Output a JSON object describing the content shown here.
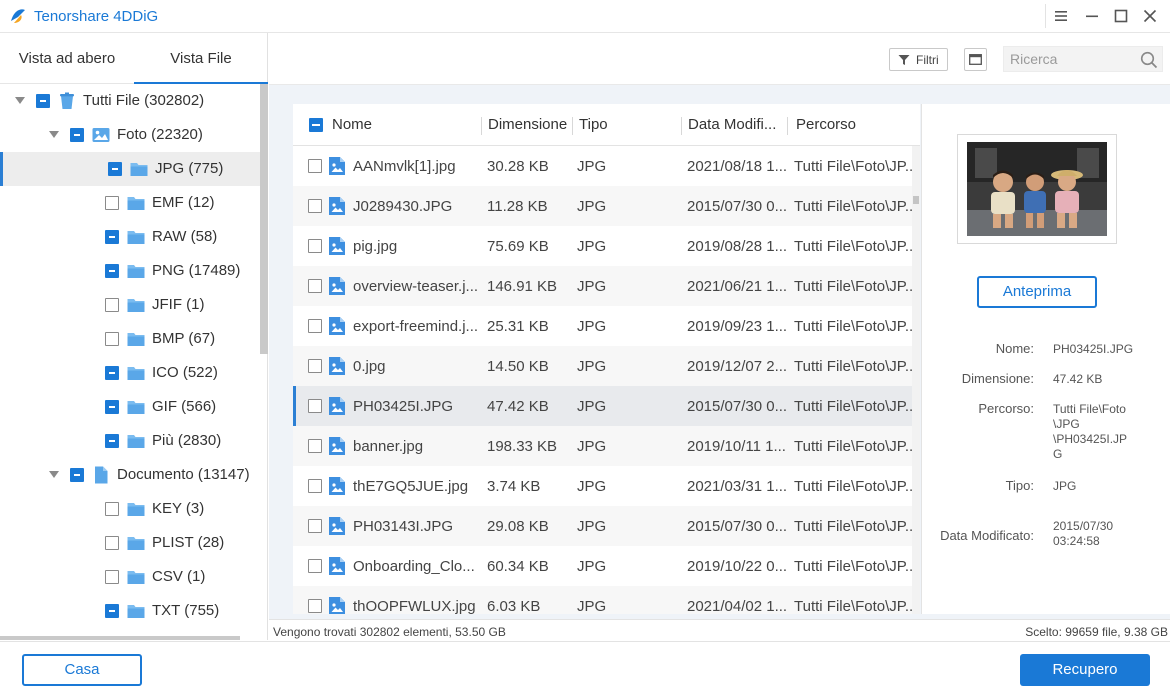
{
  "app": {
    "title": "Tenorshare 4DDiG",
    "logo": "4ddig-logo-icon"
  },
  "window_controls": [
    "menu-icon",
    "minimize-icon",
    "maximize-icon",
    "close-icon"
  ],
  "tabs": [
    {
      "label": "Vista ad abero",
      "active": false
    },
    {
      "label": "Vista File",
      "active": true
    }
  ],
  "tree": [
    {
      "label": "Tutti File (302802)",
      "level": 0,
      "expanded": true,
      "check": "partial",
      "icon": "trash-icon"
    },
    {
      "label": "Foto (22320)",
      "level": 1,
      "expanded": true,
      "check": "partial",
      "icon": "image-icon"
    },
    {
      "label": "JPG (775)",
      "level": 2,
      "check": "partial",
      "icon": "folder-icon",
      "selected": true
    },
    {
      "label": "EMF (12)",
      "level": 2,
      "check": "none",
      "icon": "folder-icon"
    },
    {
      "label": "RAW (58)",
      "level": 2,
      "check": "partial",
      "icon": "folder-icon"
    },
    {
      "label": "PNG (17489)",
      "level": 2,
      "check": "partial",
      "icon": "folder-icon"
    },
    {
      "label": "JFIF (1)",
      "level": 2,
      "check": "none",
      "icon": "folder-icon"
    },
    {
      "label": "BMP (67)",
      "level": 2,
      "check": "none",
      "icon": "folder-icon"
    },
    {
      "label": "ICO (522)",
      "level": 2,
      "check": "partial",
      "icon": "folder-icon"
    },
    {
      "label": "GIF (566)",
      "level": 2,
      "check": "partial",
      "icon": "folder-icon"
    },
    {
      "label": "Più (2830)",
      "level": 2,
      "check": "partial",
      "icon": "folder-icon"
    },
    {
      "label": "Documento (13147)",
      "level": 1,
      "expanded": true,
      "check": "partial",
      "icon": "document-icon"
    },
    {
      "label": "KEY (3)",
      "level": 2,
      "check": "none",
      "icon": "folder-icon"
    },
    {
      "label": "PLIST (28)",
      "level": 2,
      "check": "none",
      "icon": "folder-icon"
    },
    {
      "label": "CSV (1)",
      "level": 2,
      "check": "none",
      "icon": "folder-icon"
    },
    {
      "label": "TXT (755)",
      "level": 2,
      "check": "partial",
      "icon": "folder-icon"
    }
  ],
  "toolbar": {
    "filter_label": "Filtri",
    "search_placeholder": "Ricerca"
  },
  "table": {
    "columns": [
      "Nome",
      "Dimensione",
      "Tipo",
      "Data Modifi...",
      "Percorso"
    ],
    "rows": [
      {
        "name": "AANmvlk[1].jpg",
        "size": "30.28 KB",
        "type": "JPG",
        "date": "2021/08/18 1...",
        "path": "Tutti File\\Foto\\JP..."
      },
      {
        "name": "J0289430.JPG",
        "size": "11.28 KB",
        "type": "JPG",
        "date": "2015/07/30 0...",
        "path": "Tutti File\\Foto\\JP..."
      },
      {
        "name": "pig.jpg",
        "size": "75.69 KB",
        "type": "JPG",
        "date": "2019/08/28 1...",
        "path": "Tutti File\\Foto\\JP..."
      },
      {
        "name": "overview-teaser.j...",
        "size": "146.91 KB",
        "type": "JPG",
        "date": "2021/06/21 1...",
        "path": "Tutti File\\Foto\\JP..."
      },
      {
        "name": "export-freemind.j...",
        "size": "25.31 KB",
        "type": "JPG",
        "date": "2019/09/23 1...",
        "path": "Tutti File\\Foto\\JP..."
      },
      {
        "name": "0.jpg",
        "size": "14.50 KB",
        "type": "JPG",
        "date": "2019/12/07 2...",
        "path": "Tutti File\\Foto\\JP..."
      },
      {
        "name": "PH03425I.JPG",
        "size": "47.42 KB",
        "type": "JPG",
        "date": "2015/07/30 0...",
        "path": "Tutti File\\Foto\\JP...",
        "selected": true
      },
      {
        "name": "banner.jpg",
        "size": "198.33 KB",
        "type": "JPG",
        "date": "2019/10/11 1...",
        "path": "Tutti File\\Foto\\JP..."
      },
      {
        "name": "thE7GQ5JUE.jpg",
        "size": "3.74 KB",
        "type": "JPG",
        "date": "2021/03/31 1...",
        "path": "Tutti File\\Foto\\JP..."
      },
      {
        "name": "PH03143I.JPG",
        "size": "29.08 KB",
        "type": "JPG",
        "date": "2015/07/30 0...",
        "path": "Tutti File\\Foto\\JP..."
      },
      {
        "name": "Onboarding_Clo...",
        "size": "60.34 KB",
        "type": "JPG",
        "date": "2019/10/22 0...",
        "path": "Tutti File\\Foto\\JP..."
      },
      {
        "name": "thOOPFWLUX.jpg",
        "size": "6.03 KB",
        "type": "JPG",
        "date": "2021/04/02 1...",
        "path": "Tutti File\\Foto\\JP..."
      }
    ]
  },
  "preview": {
    "button_label": "Anteprima",
    "fields": [
      {
        "label": "Nome:",
        "value": "PH03425I.JPG"
      },
      {
        "label": "Dimensione:",
        "value": "47.42 KB"
      },
      {
        "label": "Percorso:",
        "value": "Tutti File\\Foto\n\\JPG\n\\PH03425I.JP\nG"
      },
      {
        "label": "Tipo:",
        "value": "JPG"
      },
      {
        "label": "Data Modificato:",
        "value": "2015/07/30\n03:24:58"
      }
    ]
  },
  "status": {
    "left": "Vengono trovati 302802 elementi, 53.50 GB",
    "right": "Scelto: 99659 file, 9.38 GB"
  },
  "footer": {
    "home_label": "Casa",
    "recover_label": "Recupero"
  },
  "colors": {
    "accent": "#1a79d6",
    "content_bg": "#eff3f8",
    "selected_row": "#e8eaed"
  }
}
